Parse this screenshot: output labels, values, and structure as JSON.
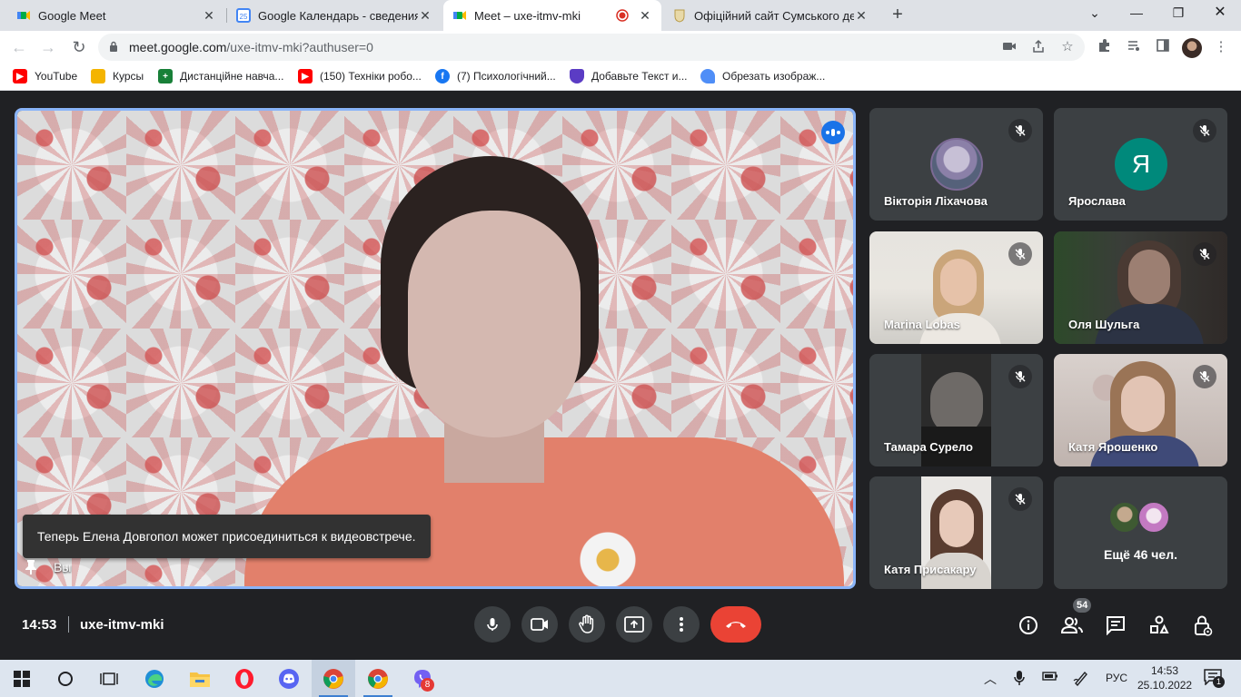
{
  "browser": {
    "tabs": [
      {
        "title": "Google Meet",
        "icon": "meet-icon"
      },
      {
        "title": "Google Календарь - сведения о",
        "icon": "calendar-icon",
        "badge": "25"
      },
      {
        "title": "Meet – uxe-itmv-mki",
        "icon": "meet-icon",
        "recording": true
      },
      {
        "title": "Офіційний сайт Сумського держ",
        "icon": "university-crest-icon"
      }
    ],
    "url_host": "meet.google.com",
    "url_path": "/uxe-itmv-mki?authuser=0",
    "bookmarks": [
      {
        "label": "YouTube",
        "icon": "youtube-icon"
      },
      {
        "label": "Курсы",
        "icon": "classroom-icon"
      },
      {
        "label": "Дистанційне навча...",
        "icon": "plus-icon"
      },
      {
        "label": "(150) Техніки робо...",
        "icon": "youtube-icon"
      },
      {
        "label": "(7) Психологічний...",
        "icon": "facebook-icon"
      },
      {
        "label": "Добавьте Текст и...",
        "icon": "shield-icon"
      },
      {
        "label": "Обрезать изображ...",
        "icon": "heart-icon"
      }
    ]
  },
  "meet": {
    "toast": "Теперь Елена Довгопол может присоединиться к видеовстрече.",
    "self_label": "Вы",
    "participants": [
      {
        "name": "Вікторія Ліхачова",
        "type": "picture-avatar"
      },
      {
        "name": "Ярослава",
        "type": "initial",
        "initial": "Я"
      },
      {
        "name": "Marina Lobas",
        "type": "camera"
      },
      {
        "name": "Оля Шульга",
        "type": "camera"
      },
      {
        "name": "Тамара Сурело",
        "type": "camera"
      },
      {
        "name": "Катя Ярошенко",
        "type": "camera"
      },
      {
        "name": "Катя Присакару",
        "type": "camera"
      }
    ],
    "more_label": "Ещё 46 чел.",
    "time": "14:53",
    "meeting_code": "uxe-itmv-mki",
    "people_count": "54",
    "colors": {
      "accent": "#8ab4f8",
      "end_call": "#ea4335",
      "initial_avatar": "#00897b"
    }
  },
  "taskbar": {
    "language": "РУС",
    "time": "14:53",
    "date": "25.10.2022",
    "viber_badge": "8",
    "notifications": "1"
  }
}
